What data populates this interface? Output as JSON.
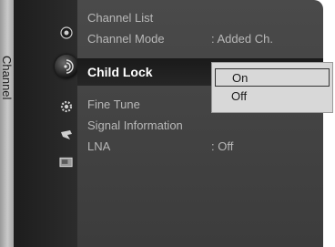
{
  "side_tab": {
    "label": "Channel"
  },
  "icons": [
    {
      "name": "picture-icon"
    },
    {
      "name": "channel-icon"
    },
    {
      "name": "setup-icon"
    },
    {
      "name": "input-icon"
    },
    {
      "name": "application-icon"
    }
  ],
  "menu": {
    "items": [
      {
        "label": "Channel List",
        "value": ""
      },
      {
        "label": "Channel Mode",
        "value": ": Added Ch."
      },
      {
        "label": "Child Lock",
        "value": ""
      },
      {
        "label": "Fine Tune",
        "value": ""
      },
      {
        "label": "Signal Information",
        "value": ""
      },
      {
        "label": "LNA",
        "value": ": Off"
      }
    ]
  },
  "dropdown": {
    "options": [
      {
        "label": "On",
        "selected": true
      },
      {
        "label": "Off",
        "selected": false
      }
    ]
  },
  "colors": {
    "panel": "#404040",
    "highlight_text": "#ffffff",
    "dropdown_bg": "#d8d8d8"
  }
}
